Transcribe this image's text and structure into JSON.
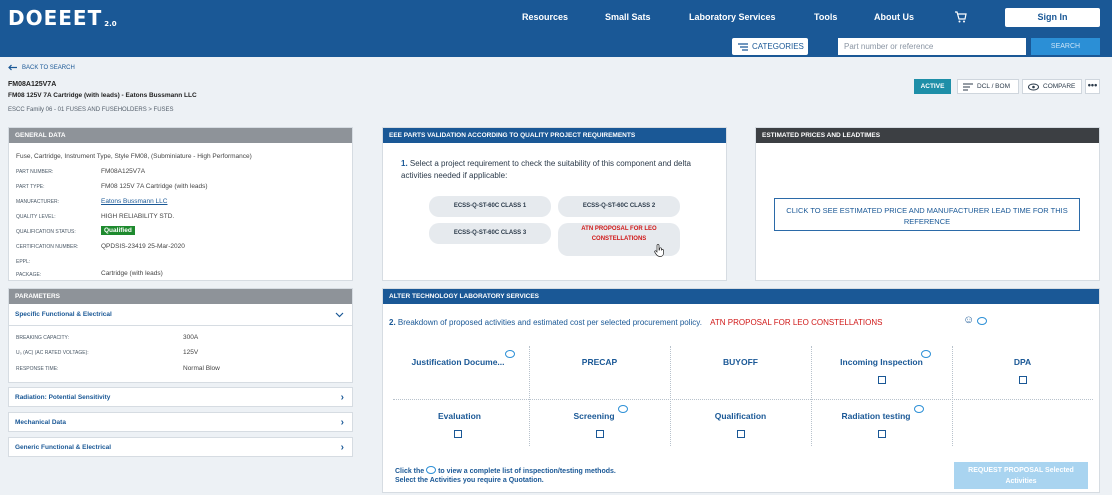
{
  "header": {
    "logo": "DOEEET",
    "logo_version": "2.0",
    "nav": [
      "Resources",
      "Small Sats",
      "Laboratory Services",
      "Tools",
      "About Us"
    ],
    "cart_icon": "cart-icon",
    "sign_in": "Sign In",
    "categories": "CATEGORIES",
    "search_placeholder": "Part number or reference",
    "search_button": "SEARCH"
  },
  "breadcrumb": {
    "back": "BACK TO SEARCH",
    "part_number": "FM08A125V7A",
    "part_title": "FM08 125V 7A Cartridge (with leads) - Eatons Bussmann LLC",
    "path": "ESCC Family 06 - 01  FUSES AND FUSEHOLDERS  >  FUSES"
  },
  "toolbar": {
    "status": "ACTIVE",
    "dcl_bom": "DCL / BOM",
    "compare": "COMPARE",
    "more": "•••"
  },
  "general_data": {
    "title": "GENERAL DATA",
    "description": "Fuse, Cartridge, Instrument Type, Style FM08, (Subminiature - High Performance)",
    "rows": [
      {
        "label": "PART NUMBER:",
        "value": "FM08A125V7A"
      },
      {
        "label": "PART TYPE:",
        "value": "FM08 125V 7A Cartridge (with leads)"
      },
      {
        "label": "MANUFACTURER:",
        "value": "Eatons Bussmann LLC"
      },
      {
        "label": "QUALITY LEVEL:",
        "value": "HIGH RELIABILITY STD."
      },
      {
        "label": "QUALIFICATION STATUS:",
        "value": "Qualified"
      },
      {
        "label": "CERTIFICATION NUMBER:",
        "value": "QPDSIS-23419 25-Mar-2020"
      },
      {
        "label": "EPPL:",
        "value": ""
      },
      {
        "label": "PACKAGE:",
        "value": "Cartridge (with leads)"
      }
    ]
  },
  "parameters": {
    "title": "PARAMETERS",
    "specific": "Specific Functional & Electrical",
    "rows": [
      {
        "label": "BREAKING CAPACITY:",
        "value": "300A"
      },
      {
        "label": "U₀ (AC) (AC RATED VOLTAGE):",
        "value": "125V"
      },
      {
        "label": "RESPONSE TIME:",
        "value": "Normal Blow"
      }
    ],
    "sections": [
      "Radiation: Potential Sensitivity",
      "Mechanical Data",
      "Generic Functional & Electrical"
    ]
  },
  "validation": {
    "title": "EEE PARTS VALIDATION ACCORDING TO QUALITY PROJECT REQUIREMENTS",
    "step": "1.",
    "question": "Select a project requirement to check the suitability of this component and delta activities needed if applicable:",
    "options": [
      "ECSS-Q-ST-60C CLASS 1",
      "ECSS-Q-ST-60C CLASS 2",
      "ECSS-Q-ST-60C CLASS 3",
      "ATN PROPOSAL FOR LEO CONSTELLATIONS"
    ]
  },
  "prices": {
    "title": "ESTIMATED PRICES AND LEADTIMES",
    "button": "CLICK TO SEE ESTIMATED PRICE AND MANUFACTURER LEAD TIME FOR THIS REFERENCE"
  },
  "lab": {
    "title": "ALTER TECHNOLOGY LABORATORY SERVICES",
    "step": "2.",
    "question": "Breakdown of proposed activities and estimated cost per selected procurement policy.",
    "policy": "ATN PROPOSAL FOR LEO CONSTELLATIONS",
    "policy_icons": "☺",
    "activities_row1": [
      "Justification Docume...",
      "PRECAP",
      "BUYOFF",
      "Incoming Inspection",
      "DPA"
    ],
    "activities_row2": [
      "Evaluation",
      "Screening",
      "Qualification",
      "Radiation testing"
    ],
    "footer_1a": "Click the",
    "footer_1b": "to view a complete list of inspection/testing methods.",
    "footer_2": "Select the Activities you require a Quotation.",
    "request_button": "REQUEST PROPOSAL Selected Activities"
  },
  "colors": {
    "brand": "#1a5896",
    "accent": "#2b8fd6",
    "active": "#1e8fa8",
    "qualified": "#1e8a2e",
    "highlight": "#d01818"
  }
}
